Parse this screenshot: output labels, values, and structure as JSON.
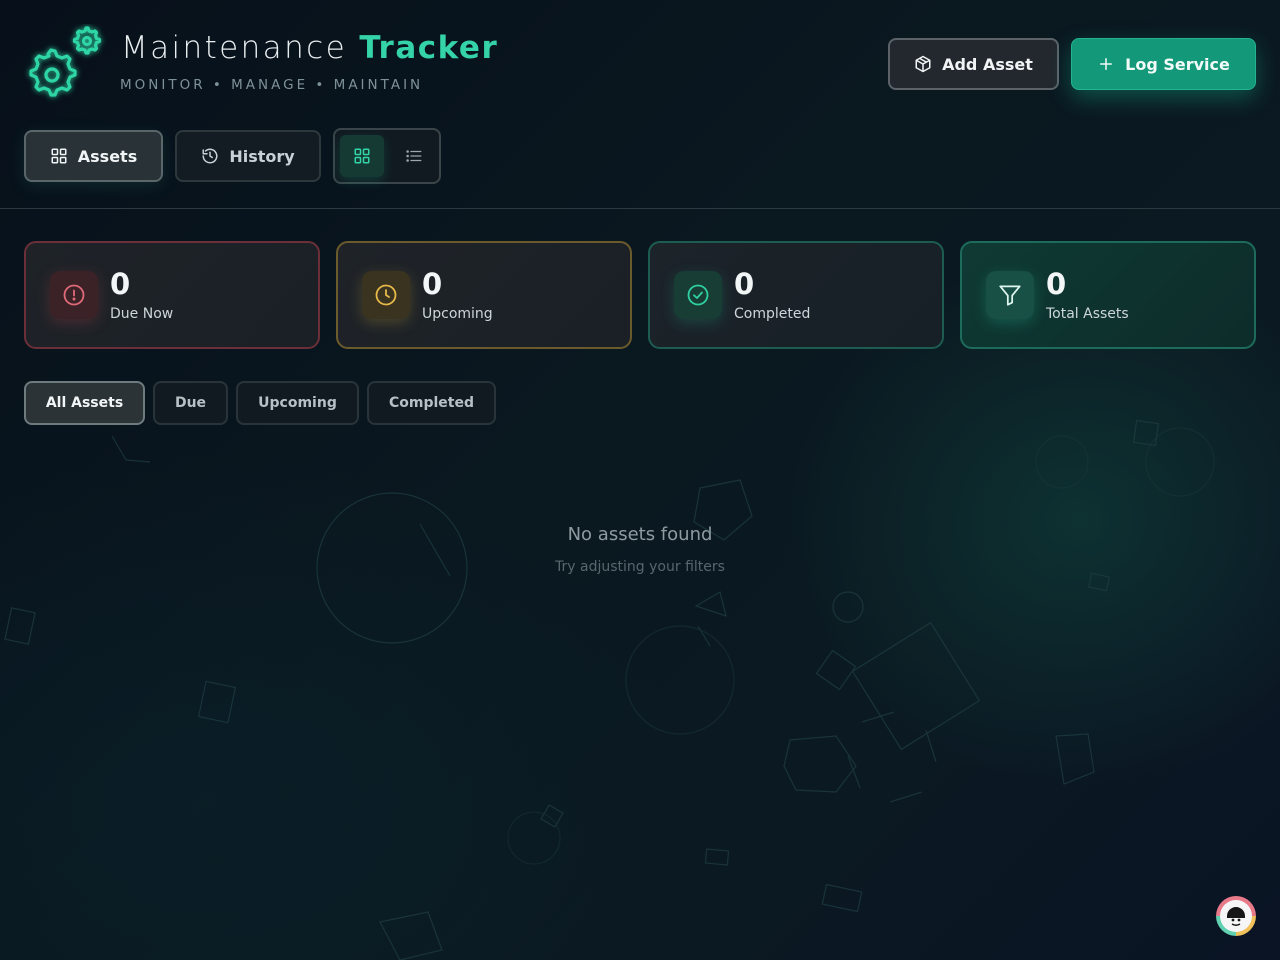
{
  "header": {
    "title_main": "Maintenance",
    "title_accent": "Tracker",
    "subtitle": "MONITOR • MANAGE • MAINTAIN",
    "add_asset_label": "Add Asset",
    "log_service_label": "Log Service"
  },
  "nav": {
    "assets_label": "Assets",
    "history_label": "History",
    "view_mode": "grid"
  },
  "stats": [
    {
      "value": "0",
      "label": "Due Now",
      "icon": "alert-circle-icon",
      "color": "#e06a78"
    },
    {
      "value": "0",
      "label": "Upcoming",
      "icon": "clock-icon",
      "color": "#e6b94a"
    },
    {
      "value": "0",
      "label": "Completed",
      "icon": "check-circle-icon",
      "color": "#2fd0a2"
    },
    {
      "value": "0",
      "label": "Total Assets",
      "icon": "filter-icon",
      "color": "#dff6f0"
    }
  ],
  "filters": {
    "all": "All Assets",
    "due": "Due",
    "upcoming": "Upcoming",
    "completed": "Completed",
    "active": "All Assets"
  },
  "empty_state": {
    "title": "No assets found",
    "subtitle": "Try adjusting your filters"
  },
  "colors": {
    "accent": "#34d3a8",
    "primary_button": "#13997a"
  }
}
